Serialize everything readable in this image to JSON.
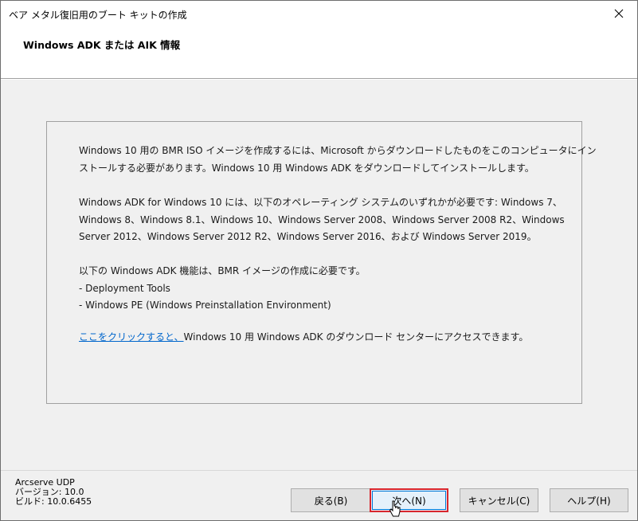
{
  "window": {
    "title": "ベア メタル復旧用のブート キットの作成",
    "close_icon": "close-icon"
  },
  "header": {
    "heading": "Windows ADK または AIK 情報"
  },
  "info": {
    "line1": "Windows 10 用の BMR ISO イメージを作成するには、Microsoft からダウンロードしたものをこのコンピュータにイン",
    "line2": "ストールする必要があります。Windows 10 用 Windows ADK をダウンロードしてインストールします。",
    "line3": "Windows ADK for Windows 10 には、以下のオペレーティング システムのいずれかが必要です: Windows 7、",
    "line4": "Windows 8、Windows 8.1、Windows 10、Windows Server 2008、Windows Server 2008 R2、Windows",
    "line5": "Server 2012、Windows Server 2012 R2、Windows Server 2016、および Windows Server 2019。",
    "line6": "以下の Windows ADK 機能は、BMR イメージの作成に必要です。",
    "line7": "- Deployment Tools",
    "line8": "- Windows PE (Windows Preinstallation Environment)",
    "link_text": "ここをクリックすると、",
    "link_suffix": "Windows 10 用 Windows ADK のダウンロード センターにアクセスできます。"
  },
  "footer": {
    "product": "Arcserve UDP",
    "version": "バージョン: 10.0",
    "build": "ビルド: 10.0.6455"
  },
  "buttons": {
    "back": "戻る(B)",
    "next": "次へ(N)",
    "cancel": "キャンセル(C)",
    "help": "ヘルプ(H)"
  },
  "colors": {
    "highlight_border": "#d8262d",
    "link": "#0066cc",
    "dialog_bg": "#f0f0f0"
  }
}
